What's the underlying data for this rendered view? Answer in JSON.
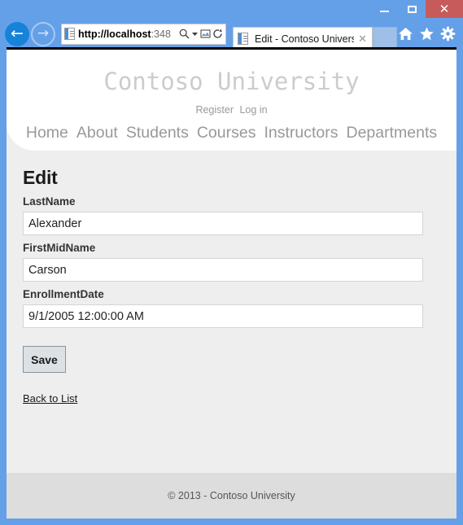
{
  "browser": {
    "window_controls": {
      "minimize": "minimize-button",
      "maximize": "maximize-button",
      "close": "✕"
    },
    "back_label": "←",
    "forward_label": "→",
    "address": {
      "host": "http://localhost",
      "rest": ":348",
      "full": "http://localhost:348"
    },
    "address_icons": {
      "search": "search-icon",
      "dropdown": "▾",
      "compatibility": "compatibility-view-icon",
      "refresh": "↻"
    },
    "tab": {
      "title": "Edit - Contoso University",
      "close": "✕"
    },
    "toolbar_icons": {
      "home": "home-icon",
      "favorites": "star-icon",
      "settings": "gear-icon"
    }
  },
  "site": {
    "brand": "Contoso University",
    "auth_links": [
      {
        "label": "Register"
      },
      {
        "label": "Log in"
      }
    ],
    "nav_links": [
      {
        "label": "Home"
      },
      {
        "label": "About"
      },
      {
        "label": "Students"
      },
      {
        "label": "Courses"
      },
      {
        "label": "Instructors"
      },
      {
        "label": "Departments"
      }
    ]
  },
  "page": {
    "title": "Edit",
    "fields": [
      {
        "label": "LastName",
        "value": "Alexander"
      },
      {
        "label": "FirstMidName",
        "value": "Carson"
      },
      {
        "label": "EnrollmentDate",
        "value": "9/1/2005 12:00:00 AM"
      }
    ],
    "save_label": "Save",
    "back_link_label": "Back to List"
  },
  "footer": {
    "copyright": "© 2013 - Contoso University"
  },
  "colors": {
    "window_chrome": "#64a0e8",
    "close_button": "#c75b5b",
    "back_button": "#1683d8",
    "page_background": "#eeeeee",
    "footer_background": "#dddddd",
    "brand_text": "#cccccc",
    "nav_text": "#999999"
  }
}
